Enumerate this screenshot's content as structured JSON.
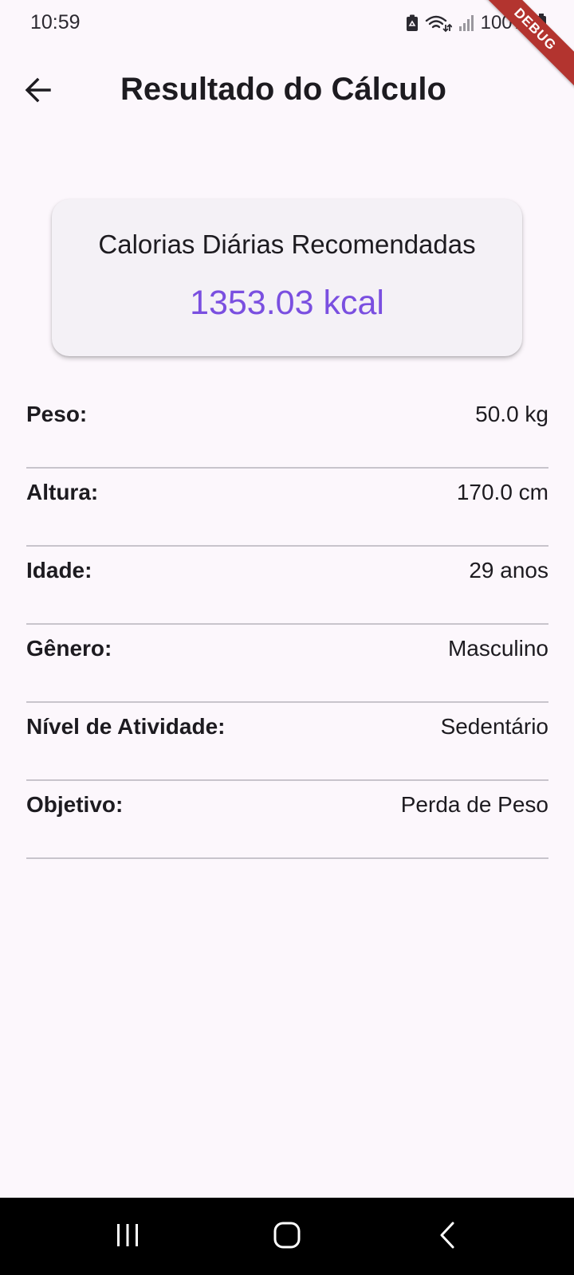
{
  "status_bar": {
    "time": "10:59",
    "battery": "100%"
  },
  "ribbon": {
    "label": "DEBUG"
  },
  "app_bar": {
    "title": "Resultado do Cálculo"
  },
  "card": {
    "title": "Calorias Diárias Recomendadas",
    "value": "1353.03 kcal",
    "accent_color": "#7a4fe0"
  },
  "details": [
    {
      "label": "Peso:",
      "value": "50.0 kg"
    },
    {
      "label": "Altura:",
      "value": "170.0 cm"
    },
    {
      "label": "Idade:",
      "value": "29 anos"
    },
    {
      "label": "Gênero:",
      "value": "Masculino"
    },
    {
      "label": "Nível de Atividade:",
      "value": "Sedentário"
    },
    {
      "label": "Objetivo:",
      "value": "Perda de Peso"
    }
  ],
  "icons": {
    "back": "arrow-left-icon",
    "recents": "recents-icon",
    "home": "home-icon",
    "nav_back": "chevron-left-icon"
  },
  "colors": {
    "background": "#fcf7fc",
    "card_background": "#f4f1f6",
    "ribbon": "#b3342f"
  }
}
